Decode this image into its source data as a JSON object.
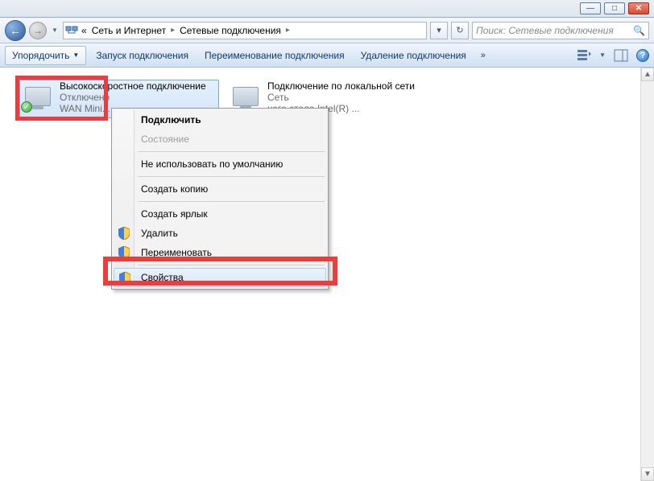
{
  "window_buttons": {
    "min": "—",
    "max": "□",
    "close": "✕"
  },
  "address": {
    "crumb0": "«",
    "crumb1": "Сеть и Интернет",
    "crumb2": "Сетевые подключения",
    "refresh": "↻"
  },
  "search": {
    "placeholder": "Поиск: Сетевые подключения"
  },
  "toolbar": {
    "organise": "Упорядочить",
    "start": "Запуск подключения",
    "rename": "Переименование подключения",
    "delete": "Удаление подключения"
  },
  "connections": {
    "c1": {
      "title": "Высокоскоростное подключение",
      "status": "Отключено",
      "device": "WAN Mini..."
    },
    "c2": {
      "title": "Подключение по локальной сети",
      "status": "Сеть",
      "device_tail": "чего стола Intel(R) ..."
    }
  },
  "menu": {
    "connect": "Подключить",
    "status": "Состояние",
    "no_default": "Не использовать по умолчанию",
    "copy": "Создать копию",
    "shortcut": "Создать ярлык",
    "delete": "Удалить",
    "rename": "Переименовать",
    "properties": "Свойства"
  }
}
